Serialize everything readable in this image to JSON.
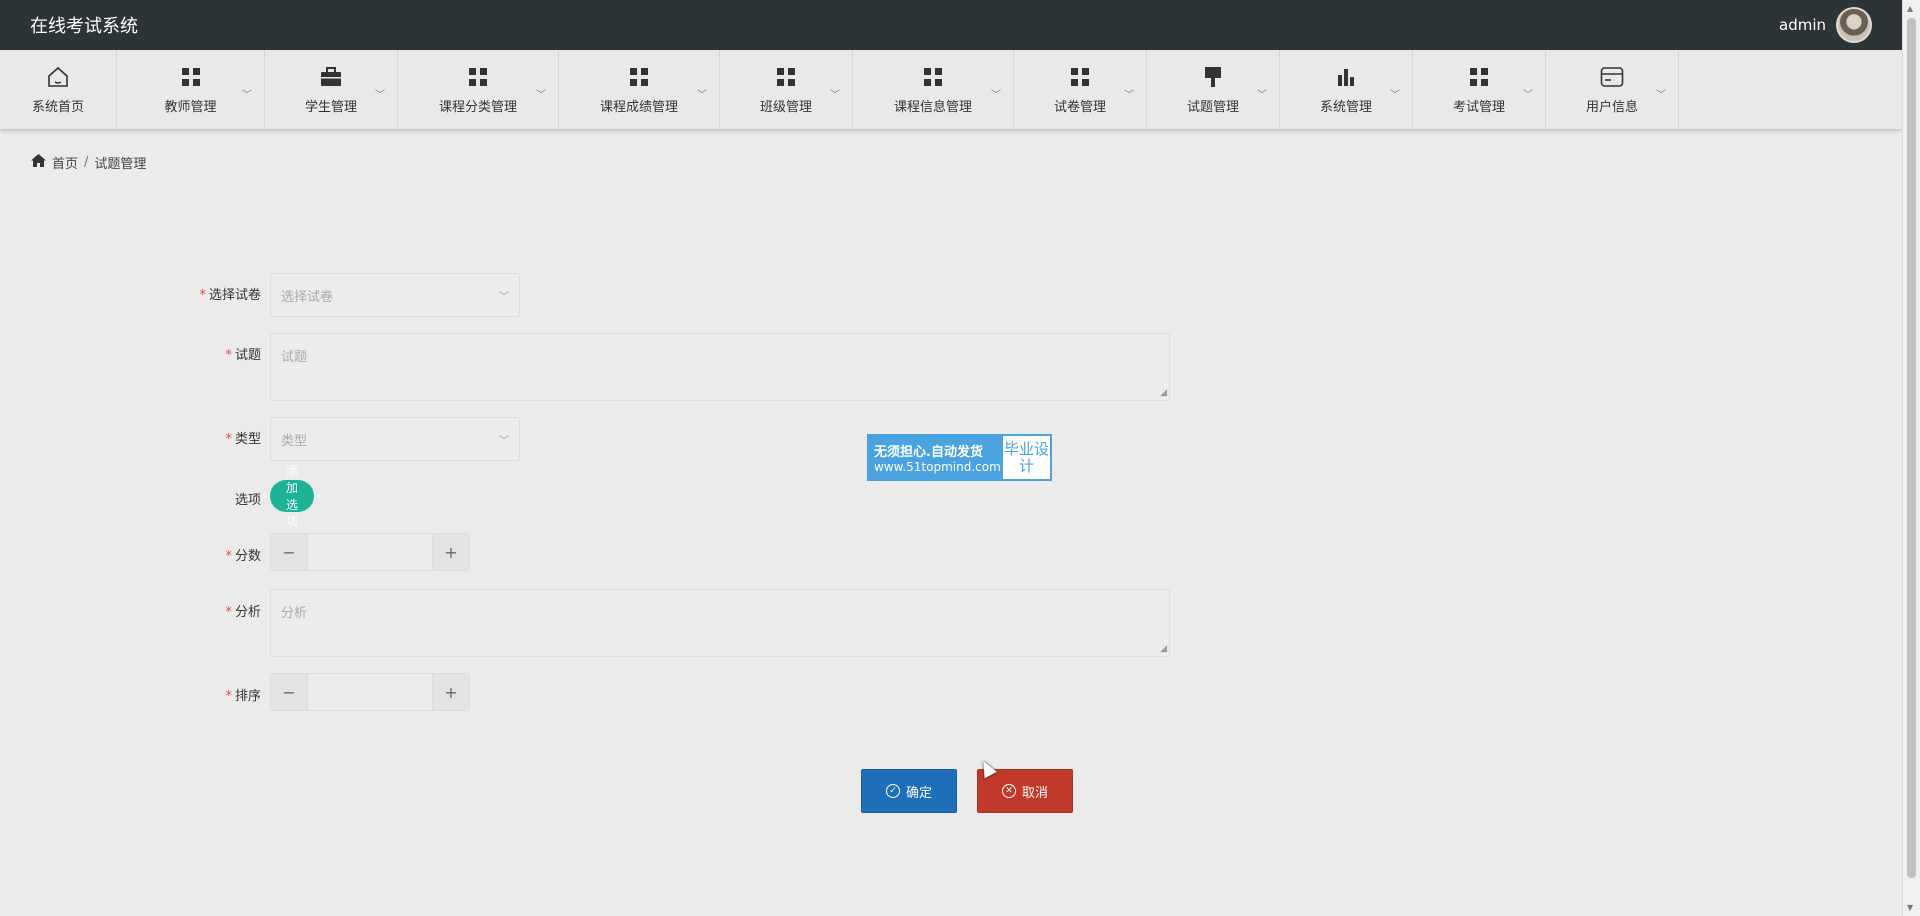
{
  "header": {
    "app_title": "在线考试系统",
    "username": "admin"
  },
  "nav": {
    "items": [
      {
        "label": "系统首页",
        "icon": "home-icon",
        "dropdown": false
      },
      {
        "label": "教师管理",
        "icon": "grid-icon",
        "dropdown": true
      },
      {
        "label": "学生管理",
        "icon": "briefcase-icon",
        "dropdown": true
      },
      {
        "label": "课程分类管理",
        "icon": "grid-icon",
        "dropdown": true
      },
      {
        "label": "课程成绩管理",
        "icon": "grid-icon",
        "dropdown": true
      },
      {
        "label": "班级管理",
        "icon": "grid-icon",
        "dropdown": true
      },
      {
        "label": "课程信息管理",
        "icon": "grid-icon",
        "dropdown": true
      },
      {
        "label": "试卷管理",
        "icon": "grid-icon",
        "dropdown": true
      },
      {
        "label": "试题管理",
        "icon": "brush-icon",
        "dropdown": true
      },
      {
        "label": "系统管理",
        "icon": "bar-chart-icon",
        "dropdown": true
      },
      {
        "label": "考试管理",
        "icon": "grid-icon",
        "dropdown": true
      },
      {
        "label": "用户信息",
        "icon": "card-icon",
        "dropdown": true
      }
    ]
  },
  "breadcrumb": {
    "home": "首页",
    "separator": "/",
    "current": "试题管理"
  },
  "form": {
    "paper": {
      "label": "选择试卷",
      "placeholder": "选择试卷",
      "required": true
    },
    "question": {
      "label": "试题",
      "placeholder": "试题",
      "required": true
    },
    "type": {
      "label": "类型",
      "placeholder": "类型",
      "required": true
    },
    "options": {
      "label": "选项",
      "button": "添加选项",
      "required": false
    },
    "score": {
      "label": "分数",
      "value": "",
      "required": true
    },
    "analysis": {
      "label": "分析",
      "placeholder": "分析",
      "required": true
    },
    "order": {
      "label": "排序",
      "value": "",
      "required": true
    },
    "required_mark": "*"
  },
  "actions": {
    "confirm": "确定",
    "cancel": "取消"
  },
  "watermark": {
    "line1": "无须担心.自动发货",
    "line2": "www.51topmind.com",
    "right": "毕业设计"
  },
  "colors": {
    "topbar": "#2d3436",
    "accent_green": "#1cb495",
    "confirm_blue": "#1f6fb8",
    "cancel_red": "#c0392b",
    "required_red": "#e74c3c"
  }
}
